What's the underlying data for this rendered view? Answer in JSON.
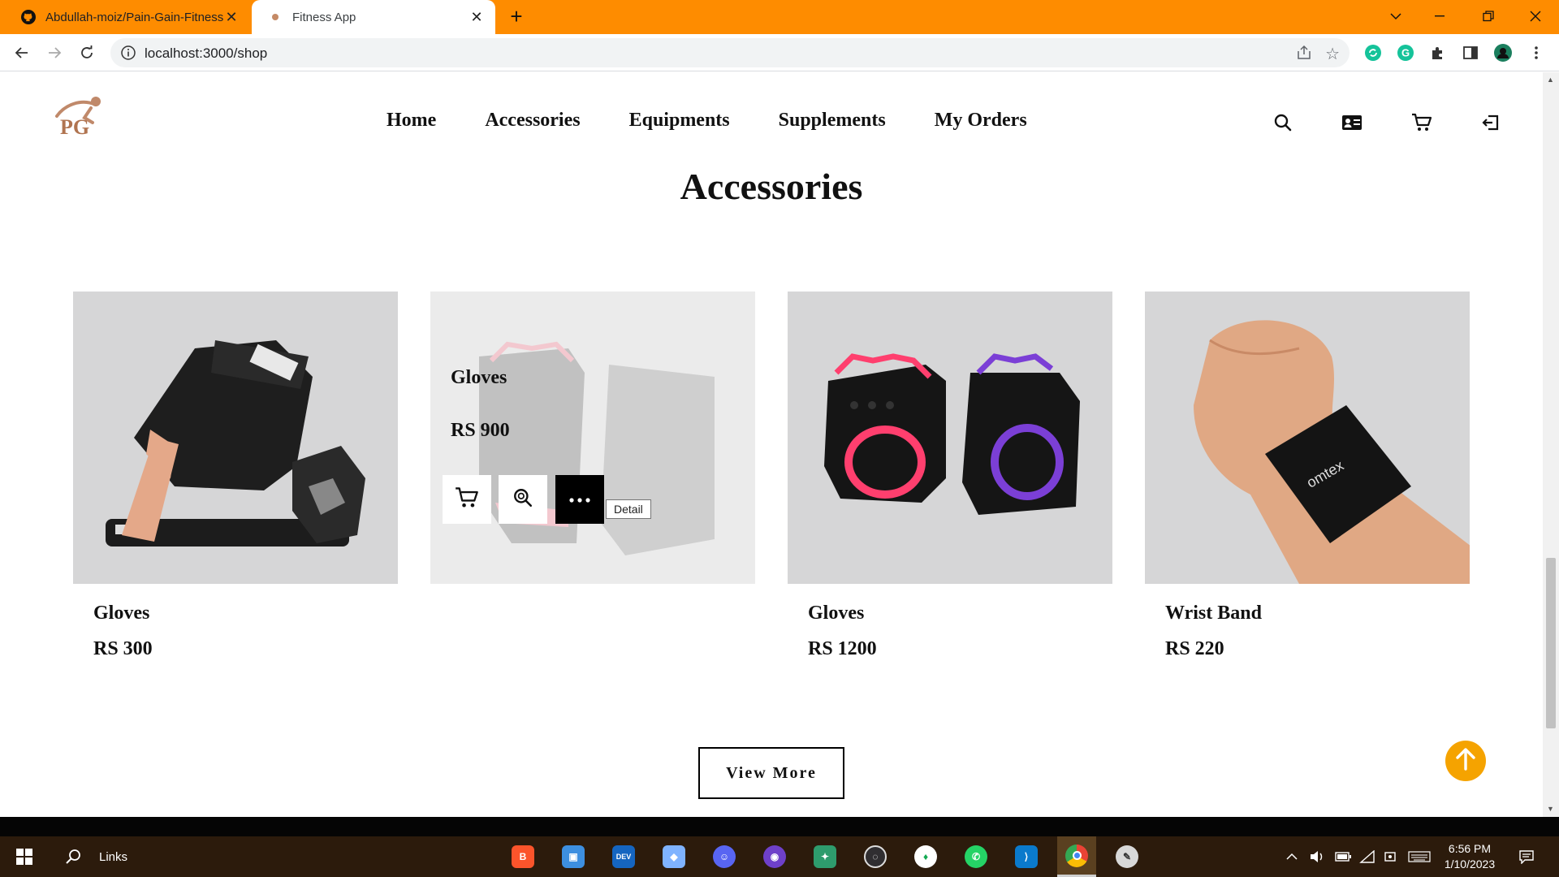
{
  "browser": {
    "tabs": [
      {
        "title": "Abdullah-moiz/Pain-Gain-Fitness",
        "icon": "github-icon",
        "active": false
      },
      {
        "title": "Fitness App",
        "icon": "site-favicon",
        "active": true
      }
    ],
    "url": "localhost:3000/shop",
    "accent_color": "#fe8c00"
  },
  "site": {
    "logo_text": "PG",
    "nav": [
      "Home",
      "Accessories",
      "Equipments",
      "Supplements",
      "My Orders"
    ],
    "header_icons": [
      "search-icon",
      "contact-card-icon",
      "cart-icon",
      "logout-icon"
    ]
  },
  "section": {
    "title": "Accessories",
    "products": [
      {
        "name": "Gloves",
        "price": "RS 300",
        "image": "black-weightlifting-gloves"
      },
      {
        "name": "Gloves",
        "price": "RS 900",
        "image": "black-red-gloves",
        "hovered": true
      },
      {
        "name": "Gloves",
        "price": "RS 1200",
        "image": "pink-purple-gloves"
      },
      {
        "name": "Wrist Band",
        "price": "RS 220",
        "image": "black-wrist-band",
        "band_text": "omtex"
      }
    ],
    "hover_tooltip": "Detail",
    "view_more": "View More"
  },
  "taskbar": {
    "search_label": "Links",
    "apps": [
      "brave",
      "file-manager",
      "dev-cx",
      "3d-app",
      "discord",
      "github-desktop",
      "git-kraken",
      "obs",
      "mongodb",
      "whatsapp",
      "vscode",
      "chrome",
      "paint"
    ],
    "time": "6:56 PM",
    "date": "1/10/2023"
  },
  "colors": {
    "scroll_top_button": "#f5a300",
    "taskbar": "#2c1b0c"
  }
}
